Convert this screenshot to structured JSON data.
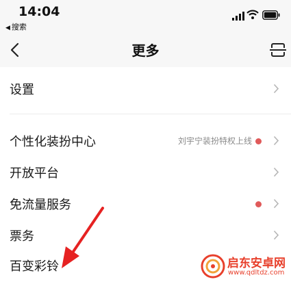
{
  "status_bar": {
    "time": "14:04",
    "back_app_label": "搜索"
  },
  "nav": {
    "title": "更多"
  },
  "rows": [
    {
      "label": "设置"
    },
    {
      "label": "个性化装扮中心",
      "subtitle": "刘宇宁装扮特权上线",
      "has_dot": true
    },
    {
      "label": "开放平台"
    },
    {
      "label": "免流量服务",
      "has_dot": true
    },
    {
      "label": "票务"
    },
    {
      "label": "百变彩铃"
    }
  ],
  "watermark": {
    "name": "启东安卓网",
    "url": "www.qdltdz.com"
  },
  "colors": {
    "background": "#ffffff",
    "header_bg": "#f7f7f7",
    "dot": "#e05a5a",
    "arrow": "#e62222",
    "watermark": "#e8402c"
  }
}
